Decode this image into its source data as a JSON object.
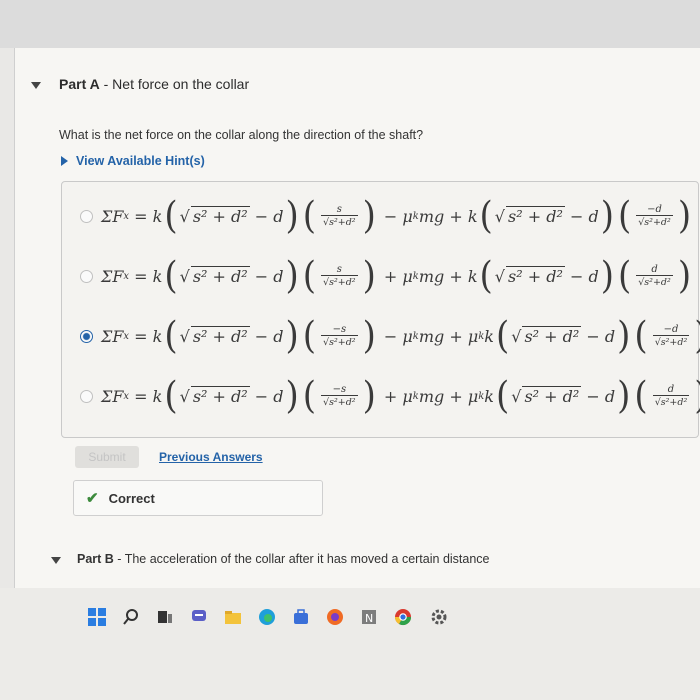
{
  "partA": {
    "label": "Part A",
    "title": "Net force on the collar"
  },
  "question": "What is the net force on the collar along the direction of the shaft?",
  "hint_link": "View Available Hint(s)",
  "options": [
    {
      "id": "opt1",
      "selected": false
    },
    {
      "id": "opt2",
      "selected": false
    },
    {
      "id": "opt3",
      "selected": true
    },
    {
      "id": "opt4",
      "selected": false
    }
  ],
  "actions": {
    "submit_label": "Submit",
    "previous_answers_label": "Previous Answers"
  },
  "feedback": {
    "status": "Correct"
  },
  "partB": {
    "label": "Part B",
    "title": "The acceleration of the collar after it has moved a certain distance"
  },
  "taskbar": {
    "icons": [
      "windows-start-icon",
      "search-icon",
      "task-view-icon",
      "chat-icon",
      "file-explorer-icon",
      "edge-icon",
      "store-icon",
      "firefox-icon",
      "notepad-icon",
      "chrome-icon",
      "settings-icon"
    ]
  },
  "colors": {
    "link": "#2463a8",
    "correct_check": "#3c8a3c",
    "background": "#f7f6f3"
  }
}
